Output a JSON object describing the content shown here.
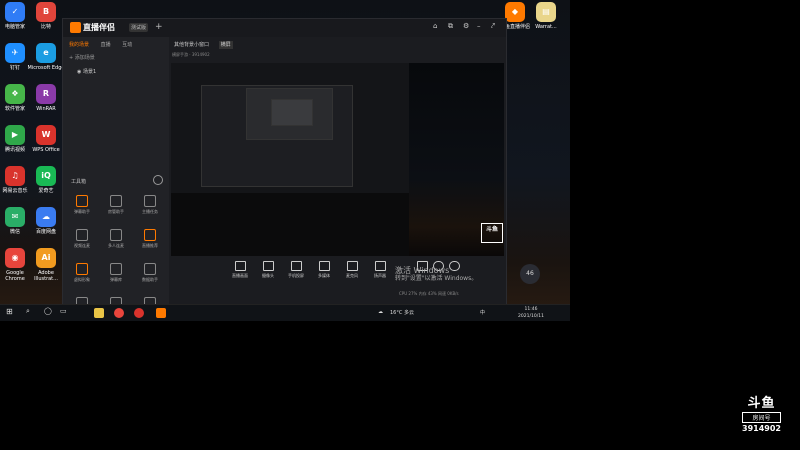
{
  "desktop": {
    "icons_left": [
      {
        "label": "电脑管家",
        "glyph": "✓",
        "color": "#2f7cf6"
      },
      {
        "label": "比特",
        "glyph": "B",
        "color": "#e0453b"
      },
      {
        "label": "钉钉",
        "glyph": "✈",
        "color": "#1f8fff"
      },
      {
        "label": "Microsoft Edge",
        "glyph": "e",
        "color": "#1b9de2"
      },
      {
        "label": "软件管家",
        "glyph": "❖",
        "color": "#46b649"
      },
      {
        "label": "WinRAR",
        "glyph": "R",
        "color": "#8a3aa8"
      },
      {
        "label": "腾讯视频",
        "glyph": "▶",
        "color": "#2fa84a"
      },
      {
        "label": "WPS Office",
        "glyph": "W",
        "color": "#d9332c"
      },
      {
        "label": "网易云音乐",
        "glyph": "♫",
        "color": "#d9332c"
      },
      {
        "label": "爱奇艺",
        "glyph": "iQ",
        "color": "#19b955"
      },
      {
        "label": "微信",
        "glyph": "✉",
        "color": "#2aae67"
      },
      {
        "label": "百度网盘",
        "glyph": "☁",
        "color": "#3a7bf0"
      },
      {
        "label": "Google Chrome",
        "glyph": "◉",
        "color": "#e8453c"
      },
      {
        "label": "Adobe Illustrat...",
        "glyph": "Ai",
        "color": "#f29b1f"
      }
    ],
    "icons_right": [
      {
        "label": "斗鱼直播伴侣",
        "glyph": "◆",
        "color": "#ff7a00"
      },
      {
        "label": "Warrat...",
        "glyph": "▤",
        "color": "#e9d58a"
      }
    ]
  },
  "app": {
    "logo": "直播伴侣",
    "version_tag": "测试版",
    "left_tabs": [
      "我的场景",
      "直播",
      "互动"
    ],
    "scenes": [
      "场景1"
    ],
    "scene_add_hint": "+ 添加场景",
    "tools_title": "工具箱",
    "tools": [
      "弹幕助手",
      "房管助手",
      "主播任务",
      "视频连麦",
      "多人连麦",
      "直播推荐",
      "虚拟形象",
      "弹幕库",
      "数据助手",
      "抽奖",
      "下载",
      "更多"
    ],
    "notice": "如何把手机游戏或电脑游戏录入?",
    "main_tabs": [
      "其他背景小窗口",
      "横屏"
    ],
    "sub_info": "横屏手游 · 3914902",
    "controls": [
      "直播画面",
      "摄像头",
      "手机投屏",
      "多媒体",
      "麦克风",
      "扬声器"
    ],
    "status_bar": "CPU 27%  内存 43%  网速 0KB/s",
    "badge": "46"
  },
  "watermark": {
    "line1": "激活 Windows",
    "line2": "转到\"设置\"以激活 Windows。"
  },
  "taskbar": {
    "weather": "16°C 多云",
    "time": "11:46",
    "date": "2021/10/11",
    "ime": "中"
  },
  "douyu": {
    "logo": "斗鱼",
    "sub": "房间号",
    "room": "3914902"
  }
}
